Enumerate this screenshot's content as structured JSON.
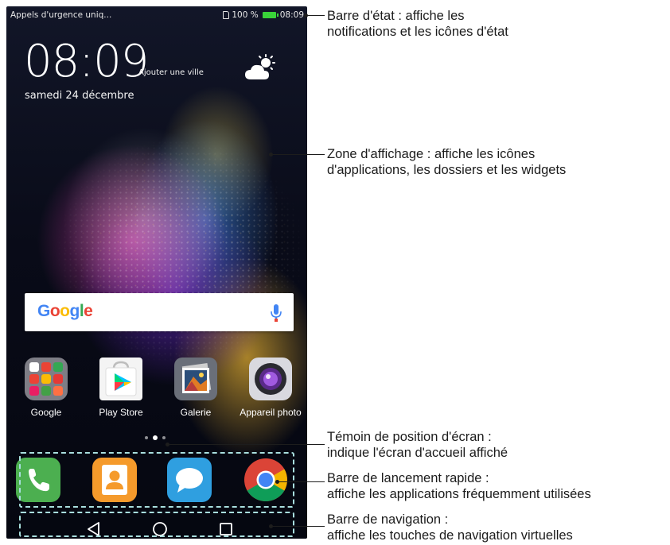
{
  "status_bar": {
    "carrier_text": "Appels d'urgence uniq...",
    "battery_percent": "100 %",
    "time": "08:09"
  },
  "lockscreen": {
    "clock": "08:09",
    "add_city": "Ajouter une ville",
    "date": "samedi 24 décembre",
    "weather_icon": "partly-cloudy-icon"
  },
  "search": {
    "logo": "Google",
    "mic_icon": "mic-icon"
  },
  "apps": [
    {
      "label": "Google",
      "icon": "google-folder-icon"
    },
    {
      "label": "Play Store",
      "icon": "play-store-icon"
    },
    {
      "label": "Galerie",
      "icon": "gallery-icon"
    },
    {
      "label": "Appareil photo",
      "icon": "camera-icon"
    }
  ],
  "page_indicator": {
    "total": 3,
    "active": 2
  },
  "dock": [
    "phone-icon",
    "contacts-icon",
    "messages-icon",
    "chrome-icon"
  ],
  "navigation": [
    "back-icon",
    "home-icon",
    "recents-icon"
  ],
  "callouts": {
    "status_bar": [
      "Barre d'état : affiche les",
      "notifications et les icônes d'état"
    ],
    "display_area": [
      "Zone d'affichage : affiche les icônes",
      "d'applications, les dossiers et les widgets"
    ],
    "screen_position": [
      "Témoin de position d'écran :",
      "indique l'écran d'accueil affiché"
    ],
    "quick_launch": [
      "Barre de lancement rapide :",
      "affiche les applications fréquemment utilisées"
    ],
    "navigation_bar": [
      "Barre de navigation :",
      "affiche les touches de navigation virtuelles"
    ]
  },
  "colors": {
    "dashed_outline": "#a8dede",
    "status_battery": "#39d339"
  }
}
